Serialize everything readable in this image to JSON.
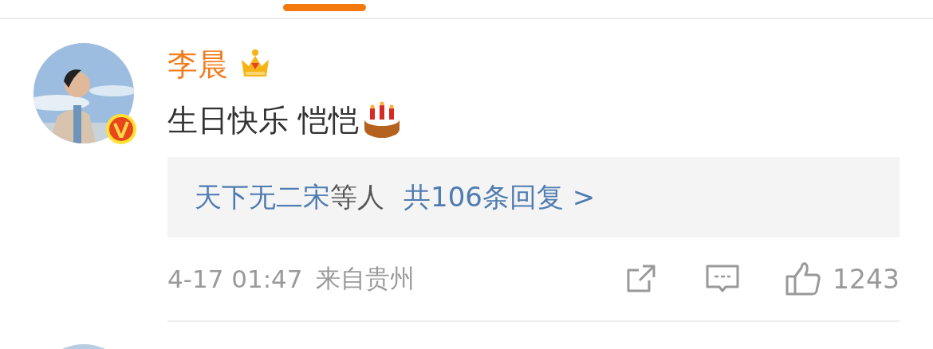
{
  "comment": {
    "author": "李晨",
    "text": "生日快乐 恺恺",
    "replies": {
      "users": "天下无二宋",
      "suffix": "等人",
      "count": "共106条回复 >"
    },
    "time": "4-17 01:47",
    "source": "来自贵州",
    "likes": "1243"
  }
}
